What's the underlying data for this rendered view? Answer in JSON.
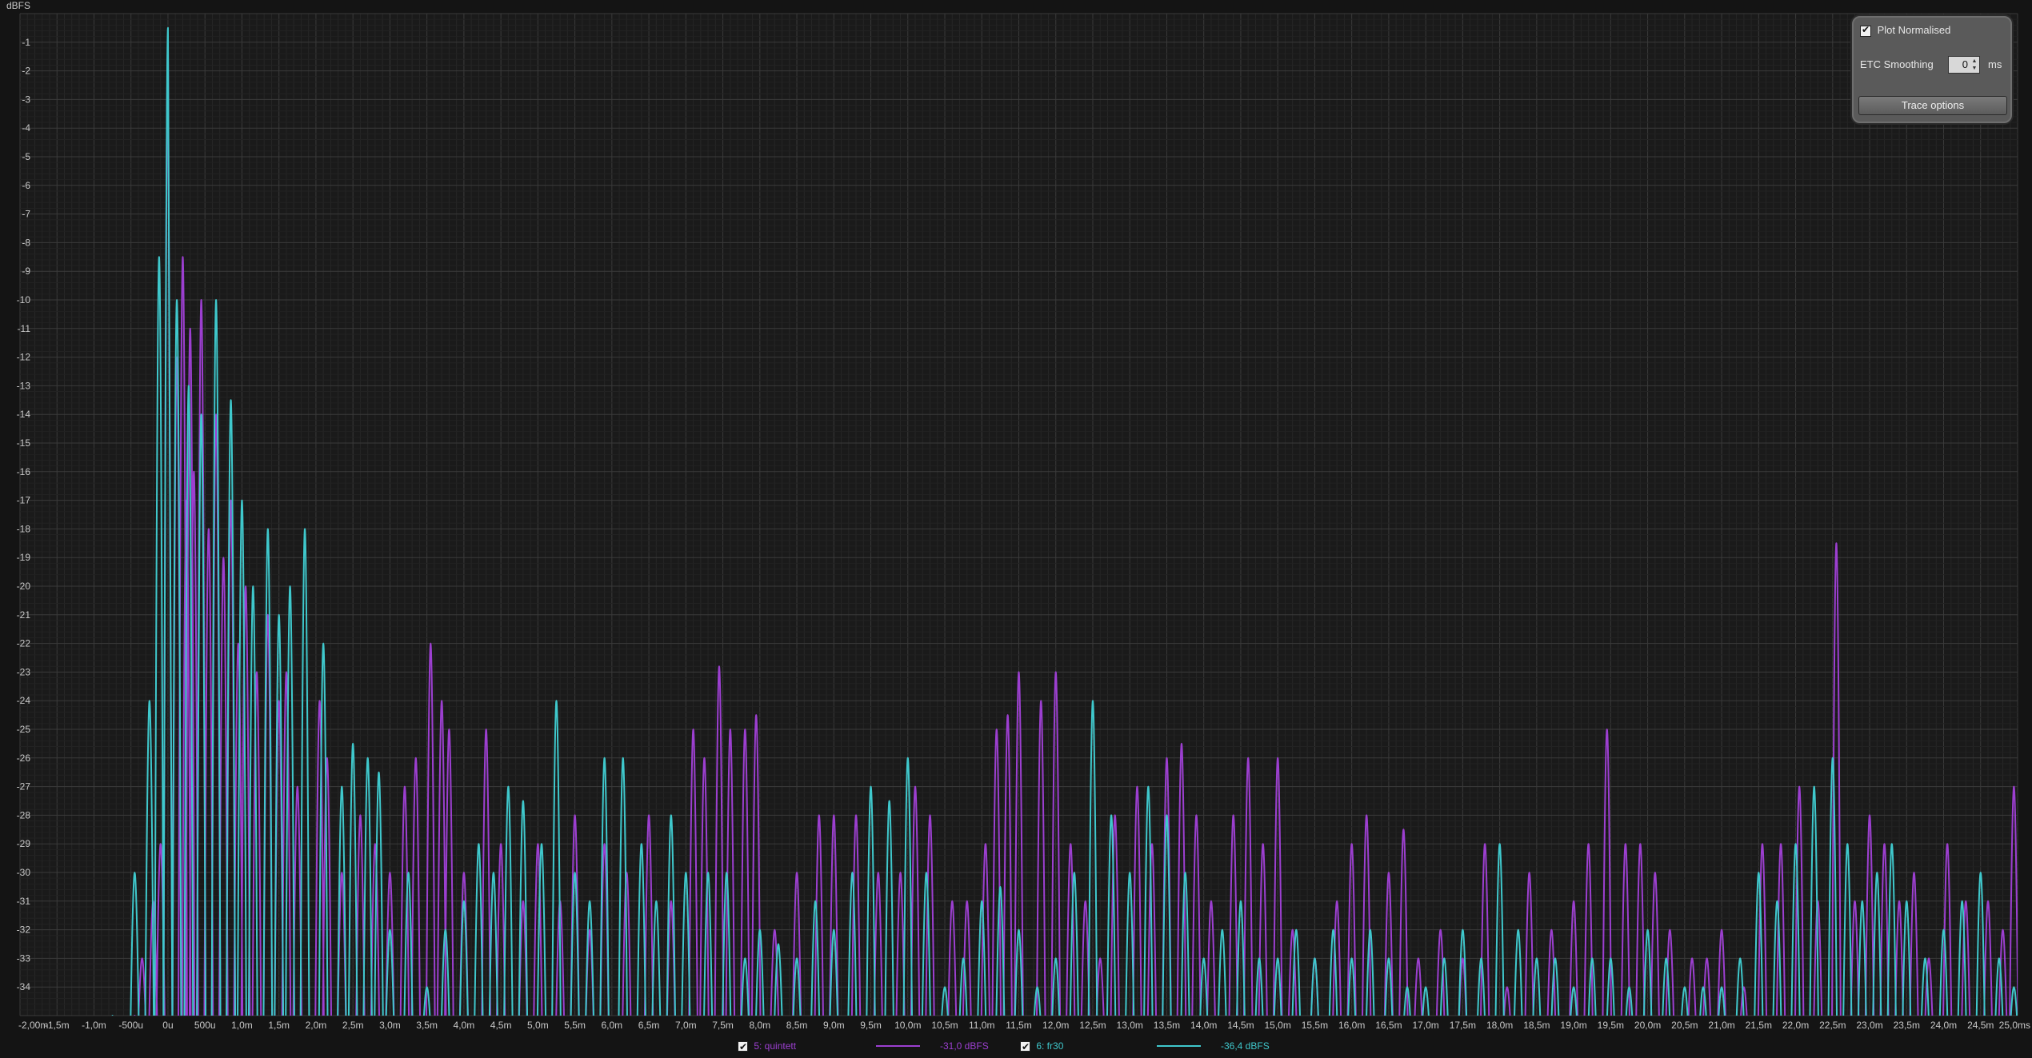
{
  "panel": {
    "plot_normalised_label": "Plot Normalised",
    "plot_normalised_checked": true,
    "etc_smoothing_label": "ETC Smoothing",
    "etc_smoothing_value": "0",
    "etc_smoothing_unit": "ms",
    "trace_options_label": "Trace options"
  },
  "legend": [
    {
      "name": "5: quintett",
      "level": "-31,0 dBFS",
      "checked": true,
      "color": "#9c3fd0"
    },
    {
      "name": "6: fr30",
      "level": "-36,4 dBFS",
      "checked": true,
      "color": "#3fc8cc"
    }
  ],
  "chart_data": {
    "type": "line",
    "title": "",
    "ylabel": "dBFS",
    "xlabel": "",
    "y_unit_label": "dBFS",
    "ylim": [
      -35,
      0
    ],
    "xlim": [
      -2.0,
      25.0
    ],
    "x_unit": "ms",
    "grid": true,
    "background": "#1a1a1a",
    "y_ticks": [
      -1,
      -2,
      -3,
      -4,
      -5,
      -6,
      -7,
      -8,
      -9,
      -10,
      -11,
      -12,
      -13,
      -14,
      -15,
      -16,
      -17,
      -18,
      -19,
      -20,
      -21,
      -22,
      -23,
      -24,
      -25,
      -26,
      -27,
      -28,
      -29,
      -30,
      -31,
      -32,
      -33,
      -34
    ],
    "y_tick_labels": [
      "-1",
      "-2",
      "-3",
      "-4",
      "-5",
      "-6",
      "-7",
      "-8",
      "-9",
      "-10",
      "-11",
      "-12",
      "-13",
      "-14",
      "-15",
      "-16",
      "-17",
      "-18",
      "-19",
      "-20",
      "-21",
      "-22",
      "-23",
      "-24",
      "-25",
      "-26",
      "-27",
      "-28",
      "-29",
      "-30",
      "-31",
      "-32",
      "-33",
      "-34"
    ],
    "x_ticks": [
      -2.0,
      -1.5,
      -1.0,
      -0.5,
      0,
      0.5,
      1.0,
      1.5,
      2.0,
      2.5,
      3.0,
      3.5,
      4.0,
      4.5,
      5.0,
      5.5,
      6.0,
      6.5,
      7.0,
      7.5,
      8.0,
      8.5,
      9.0,
      9.5,
      10.0,
      10.5,
      11.0,
      11.5,
      12.0,
      12.5,
      13.0,
      13.5,
      14.0,
      14.5,
      15.0,
      15.5,
      16.0,
      16.5,
      17.0,
      17.5,
      18.0,
      18.5,
      19.0,
      19.5,
      20.0,
      20.5,
      21.0,
      21.5,
      22.0,
      22.5,
      23.0,
      23.5,
      24.0,
      24.5,
      25.0
    ],
    "x_tick_labels": [
      "-2,00m",
      "-1,5m",
      "-1,0m",
      "-500u",
      "0u",
      "500u",
      "1,0m",
      "1,5m",
      "2,0m",
      "2,5m",
      "3,0m",
      "3,5m",
      "4,0m",
      "4,5m",
      "5,0m",
      "5,5m",
      "6,0m",
      "6,5m",
      "7,0m",
      "7,5m",
      "8,0m",
      "8,5m",
      "9,0m",
      "9,5m",
      "10,0m",
      "10,5m",
      "11,0m",
      "11,5m",
      "12,0m",
      "12,5m",
      "13,0m",
      "13,5m",
      "14,0m",
      "14,5m",
      "15,0m",
      "15,5m",
      "16,0m",
      "16,5m",
      "17,0m",
      "17,5m",
      "18,0m",
      "18,5m",
      "19,0m",
      "19,5m",
      "20,0m",
      "20,5m",
      "21,0m",
      "21,5m",
      "22,0m",
      "22,5m",
      "23,0m",
      "23,5m",
      "24,0m",
      "24,5m",
      "25,0ms"
    ],
    "series": [
      {
        "name": "5: quintett",
        "color": "#9c3fd0",
        "peaks": [
          [
            -0.45,
            -35
          ],
          [
            -0.35,
            -33
          ],
          [
            -0.2,
            -31
          ],
          [
            -0.1,
            -29
          ],
          [
            0.0,
            -1
          ],
          [
            0.12,
            -12
          ],
          [
            0.2,
            -8.5
          ],
          [
            0.25,
            -17
          ],
          [
            0.3,
            -11
          ],
          [
            0.35,
            -16
          ],
          [
            0.45,
            -10
          ],
          [
            0.55,
            -18
          ],
          [
            0.65,
            -14
          ],
          [
            0.75,
            -19
          ],
          [
            0.85,
            -17
          ],
          [
            0.95,
            -22
          ],
          [
            1.05,
            -20
          ],
          [
            1.2,
            -23
          ],
          [
            1.35,
            -21
          ],
          [
            1.5,
            -24
          ],
          [
            1.6,
            -23
          ],
          [
            1.75,
            -27
          ],
          [
            2.05,
            -24
          ],
          [
            2.15,
            -26
          ],
          [
            2.35,
            -30
          ],
          [
            2.6,
            -28
          ],
          [
            2.8,
            -29
          ],
          [
            3.0,
            -30
          ],
          [
            3.2,
            -27
          ],
          [
            3.35,
            -26
          ],
          [
            3.55,
            -22
          ],
          [
            3.7,
            -24
          ],
          [
            3.8,
            -25
          ],
          [
            4.0,
            -30
          ],
          [
            4.3,
            -25
          ],
          [
            4.5,
            -29
          ],
          [
            4.8,
            -31
          ],
          [
            5.0,
            -29
          ],
          [
            5.3,
            -31
          ],
          [
            5.5,
            -28
          ],
          [
            5.7,
            -32
          ],
          [
            5.9,
            -29
          ],
          [
            6.2,
            -30
          ],
          [
            6.5,
            -28
          ],
          [
            6.8,
            -31
          ],
          [
            7.1,
            -25
          ],
          [
            7.25,
            -26
          ],
          [
            7.45,
            -22.8
          ],
          [
            7.6,
            -25
          ],
          [
            7.8,
            -25
          ],
          [
            7.95,
            -24.5
          ],
          [
            8.2,
            -32
          ],
          [
            8.5,
            -30
          ],
          [
            8.8,
            -28
          ],
          [
            9.0,
            -28
          ],
          [
            9.3,
            -28
          ],
          [
            9.6,
            -30
          ],
          [
            9.9,
            -30
          ],
          [
            10.1,
            -27
          ],
          [
            10.3,
            -28
          ],
          [
            10.6,
            -31
          ],
          [
            10.8,
            -31
          ],
          [
            11.05,
            -29
          ],
          [
            11.2,
            -25
          ],
          [
            11.35,
            -24.5
          ],
          [
            11.5,
            -23
          ],
          [
            11.8,
            -24
          ],
          [
            12.0,
            -23
          ],
          [
            12.2,
            -29
          ],
          [
            12.4,
            -31
          ],
          [
            12.6,
            -33
          ],
          [
            12.8,
            -28
          ],
          [
            13.1,
            -27
          ],
          [
            13.3,
            -29
          ],
          [
            13.5,
            -26
          ],
          [
            13.7,
            -25.5
          ],
          [
            13.9,
            -28
          ],
          [
            14.1,
            -31
          ],
          [
            14.4,
            -28
          ],
          [
            14.6,
            -26
          ],
          [
            14.8,
            -29
          ],
          [
            15.0,
            -26
          ],
          [
            15.2,
            -32
          ],
          [
            15.5,
            -33
          ],
          [
            15.8,
            -31
          ],
          [
            16.0,
            -29
          ],
          [
            16.2,
            -28
          ],
          [
            16.5,
            -30
          ],
          [
            16.7,
            -28.5
          ],
          [
            16.9,
            -33
          ],
          [
            17.2,
            -32
          ],
          [
            17.5,
            -33
          ],
          [
            17.8,
            -29
          ],
          [
            18.1,
            -34
          ],
          [
            18.4,
            -30
          ],
          [
            18.7,
            -32
          ],
          [
            19.0,
            -31
          ],
          [
            19.2,
            -29
          ],
          [
            19.45,
            -25
          ],
          [
            19.7,
            -29
          ],
          [
            19.9,
            -29
          ],
          [
            20.1,
            -30
          ],
          [
            20.3,
            -32
          ],
          [
            20.6,
            -33
          ],
          [
            20.8,
            -33
          ],
          [
            21.0,
            -32
          ],
          [
            21.3,
            -34
          ],
          [
            21.55,
            -29
          ],
          [
            21.8,
            -29
          ],
          [
            22.05,
            -27
          ],
          [
            22.3,
            -31
          ],
          [
            22.55,
            -18.5
          ],
          [
            22.8,
            -31
          ],
          [
            23.0,
            -28
          ],
          [
            23.2,
            -29
          ],
          [
            23.4,
            -31
          ],
          [
            23.6,
            -30
          ],
          [
            23.8,
            -33
          ],
          [
            24.05,
            -29
          ],
          [
            24.3,
            -31
          ],
          [
            24.6,
            -31
          ],
          [
            24.8,
            -32
          ],
          [
            24.95,
            -27
          ]
        ]
      },
      {
        "name": "6: fr30",
        "color": "#3fc8cc",
        "peaks": [
          [
            -0.75,
            -35
          ],
          [
            -0.45,
            -30
          ],
          [
            -0.25,
            -24
          ],
          [
            -0.12,
            -8.5
          ],
          [
            0.0,
            -0.5
          ],
          [
            0.12,
            -10
          ],
          [
            0.28,
            -13
          ],
          [
            0.45,
            -14
          ],
          [
            0.65,
            -10
          ],
          [
            0.85,
            -13.5
          ],
          [
            1.0,
            -17
          ],
          [
            1.15,
            -20
          ],
          [
            1.35,
            -18
          ],
          [
            1.5,
            -21
          ],
          [
            1.65,
            -20
          ],
          [
            1.85,
            -18
          ],
          [
            2.1,
            -22
          ],
          [
            2.35,
            -27
          ],
          [
            2.5,
            -25.5
          ],
          [
            2.7,
            -26
          ],
          [
            2.85,
            -26.5
          ],
          [
            3.0,
            -32
          ],
          [
            3.25,
            -30
          ],
          [
            3.5,
            -34
          ],
          [
            3.75,
            -32
          ],
          [
            4.0,
            -31
          ],
          [
            4.2,
            -29
          ],
          [
            4.4,
            -30
          ],
          [
            4.6,
            -27
          ],
          [
            4.8,
            -27.5
          ],
          [
            5.05,
            -29
          ],
          [
            5.25,
            -24
          ],
          [
            5.5,
            -30
          ],
          [
            5.7,
            -31
          ],
          [
            5.9,
            -26
          ],
          [
            6.15,
            -26
          ],
          [
            6.4,
            -29
          ],
          [
            6.6,
            -31
          ],
          [
            6.8,
            -28
          ],
          [
            7.0,
            -30
          ],
          [
            7.3,
            -30
          ],
          [
            7.55,
            -30
          ],
          [
            7.8,
            -33
          ],
          [
            8.0,
            -32
          ],
          [
            8.25,
            -32.5
          ],
          [
            8.5,
            -33
          ],
          [
            8.75,
            -31
          ],
          [
            9.0,
            -32
          ],
          [
            9.25,
            -30
          ],
          [
            9.5,
            -27
          ],
          [
            9.75,
            -27.5
          ],
          [
            10.0,
            -26
          ],
          [
            10.25,
            -30
          ],
          [
            10.5,
            -34
          ],
          [
            10.75,
            -33
          ],
          [
            11.0,
            -31
          ],
          [
            11.25,
            -30.5
          ],
          [
            11.5,
            -32
          ],
          [
            11.75,
            -34
          ],
          [
            12.0,
            -33
          ],
          [
            12.25,
            -30
          ],
          [
            12.5,
            -24
          ],
          [
            12.75,
            -28
          ],
          [
            13.0,
            -30
          ],
          [
            13.25,
            -27
          ],
          [
            13.5,
            -28
          ],
          [
            13.75,
            -30
          ],
          [
            14.0,
            -33
          ],
          [
            14.25,
            -32
          ],
          [
            14.5,
            -31
          ],
          [
            14.75,
            -33
          ],
          [
            15.0,
            -33
          ],
          [
            15.25,
            -32
          ],
          [
            15.5,
            -33
          ],
          [
            15.75,
            -32
          ],
          [
            16.0,
            -33
          ],
          [
            16.25,
            -32
          ],
          [
            16.5,
            -33
          ],
          [
            16.75,
            -34
          ],
          [
            17.0,
            -34
          ],
          [
            17.25,
            -33
          ],
          [
            17.5,
            -32
          ],
          [
            17.75,
            -33
          ],
          [
            18.0,
            -29
          ],
          [
            18.25,
            -32
          ],
          [
            18.5,
            -33
          ],
          [
            18.75,
            -33
          ],
          [
            19.0,
            -34
          ],
          [
            19.25,
            -33
          ],
          [
            19.5,
            -33
          ],
          [
            19.75,
            -34
          ],
          [
            20.0,
            -32
          ],
          [
            20.25,
            -33
          ],
          [
            20.5,
            -34
          ],
          [
            20.75,
            -34
          ],
          [
            21.0,
            -34
          ],
          [
            21.25,
            -33
          ],
          [
            21.5,
            -30
          ],
          [
            21.75,
            -31
          ],
          [
            22.0,
            -29
          ],
          [
            22.25,
            -27
          ],
          [
            22.5,
            -26
          ],
          [
            22.7,
            -29
          ],
          [
            22.9,
            -31
          ],
          [
            23.1,
            -30
          ],
          [
            23.3,
            -29
          ],
          [
            23.5,
            -31
          ],
          [
            23.75,
            -33
          ],
          [
            24.0,
            -32
          ],
          [
            24.25,
            -31
          ],
          [
            24.5,
            -30
          ],
          [
            24.75,
            -33
          ],
          [
            24.95,
            -34
          ]
        ]
      }
    ]
  }
}
